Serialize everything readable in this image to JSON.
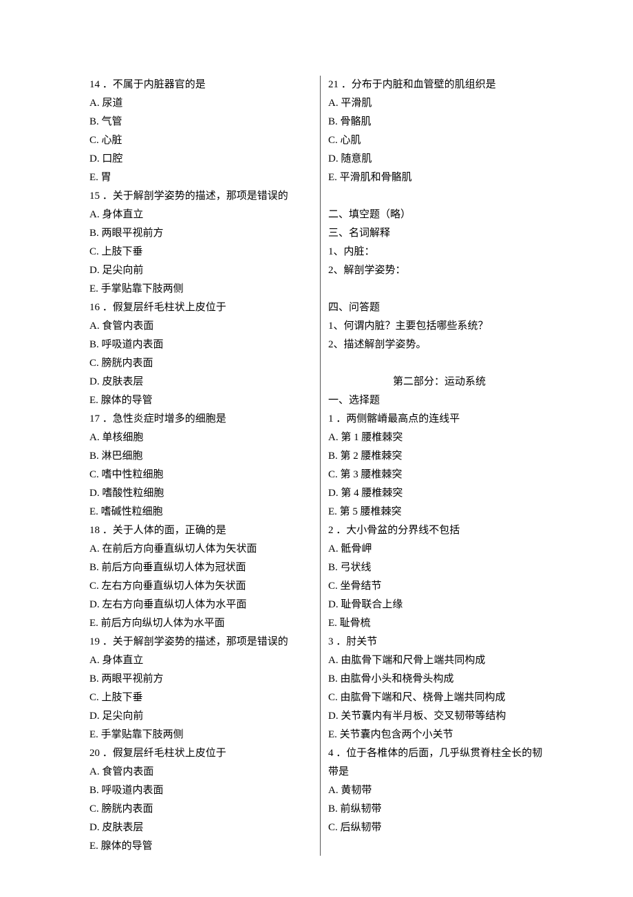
{
  "left": {
    "q14": {
      "stem": "14 ．不属于内脏器官的是",
      "a": "A. 尿道",
      "b": "B. 气管",
      "c": "C. 心脏",
      "d": "D. 口腔",
      "e": "E. 胃"
    },
    "q15": {
      "stem": "15 ．关于解剖学姿势的描述，那项是错误的",
      "a": "A. 身体直立",
      "b": "B. 两眼平视前方",
      "c": "C. 上肢下垂",
      "d": "D. 足尖向前",
      "e": "E. 手掌贴靠下肢两侧"
    },
    "q16": {
      "stem": "16 ．假复层纤毛柱状上皮位于",
      "a": "A. 食管内表面",
      "b": "B. 呼吸道内表面",
      "c": "C. 膀胱内表面",
      "d": "D. 皮肤表层",
      "e": "E. 腺体的导管"
    },
    "q17": {
      "stem": "17 ．急性炎症时增多的细胞是",
      "a": "A. 单核细胞",
      "b": "B. 淋巴细胞",
      "c": "C. 嗜中性粒细胞",
      "d": "D. 嗜酸性粒细胞",
      "e": "E. 嗜碱性粒细胞"
    },
    "q18": {
      "stem": "18 ．关于人体的面，正确的是",
      "a": "A. 在前后方向垂直纵切人体为矢状面",
      "b": "B. 前后方向垂直纵切人体为冠状面",
      "c": "C. 左右方向垂直纵切人体为矢状面",
      "d": "D. 左右方向垂直纵切人体为水平面",
      "e": "E. 前后方向纵切人体为水平面"
    },
    "q19": {
      "stem": "19 ．关于解剖学姿势的描述，那项是错误的",
      "a": "A. 身体直立",
      "b": "B. 两眼平视前方",
      "c": "C. 上肢下垂",
      "d": "D. 足尖向前",
      "e": "E. 手掌贴靠下肢两侧"
    },
    "q20": {
      "stem": "20 ．假复层纤毛柱状上皮位于",
      "a": "A. 食管内表面",
      "b": "B. 呼吸道内表面",
      "c": "C. 膀胱内表面",
      "d": "D. 皮肤表层"
    }
  },
  "right": {
    "q20e": "E. 腺体的导管",
    "q21": {
      "stem": "21 ．分布于内脏和血管壁的肌组织是",
      "a": "A. 平滑肌",
      "b": "B. 骨骼肌",
      "c": "C. 心肌",
      "d": "D. 随意肌",
      "e": "E. 平滑肌和骨骼肌"
    },
    "sec2": {
      "title": "二、填空题（略）"
    },
    "sec3": {
      "title": "三、名词解释",
      "i1": "1、内脏：",
      "i2": "2、解剖学姿势："
    },
    "sec4": {
      "title": "四、问答题",
      "i1": "1、何谓内脏？主要包括哪些系统？",
      "i2": "2、描述解剖学姿势。"
    },
    "part2": {
      "title": "第二部分：运动系统",
      "choice_title": "一、选择题",
      "q1": {
        "stem": "1 ．两侧髂嵴最高点的连线平",
        "a": "A. 第 1 腰椎棘突",
        "b": "B. 第 2 腰椎棘突",
        "c": "C. 第 3 腰椎棘突",
        "d": "D. 第 4 腰椎棘突",
        "e": "E. 第 5 腰椎棘突"
      },
      "q2": {
        "stem": "2 ．大小骨盆的分界线不包括",
        "a": "A. 骶骨岬",
        "b": "B. 弓状线",
        "c": "C. 坐骨结节",
        "d": "D. 耻骨联合上缘",
        "e": "E. 耻骨梳"
      },
      "q3": {
        "stem": "3 ．肘关节",
        "a": "A. 由肱骨下端和尺骨上端共同构成",
        "b": "B. 由肱骨小头和桡骨头构成",
        "c": "C. 由肱骨下端和尺、桡骨上端共同构成",
        "d": "D. 关节囊内有半月板、交叉韧带等结构",
        "e": "E. 关节囊内包含两个小关节"
      },
      "q4": {
        "stem": "4 ．位于各椎体的后面，几乎纵贯脊柱全长的韧带是",
        "a": "A. 黄韧带",
        "b": "B. 前纵韧带",
        "c": "C. 后纵韧带"
      }
    }
  }
}
